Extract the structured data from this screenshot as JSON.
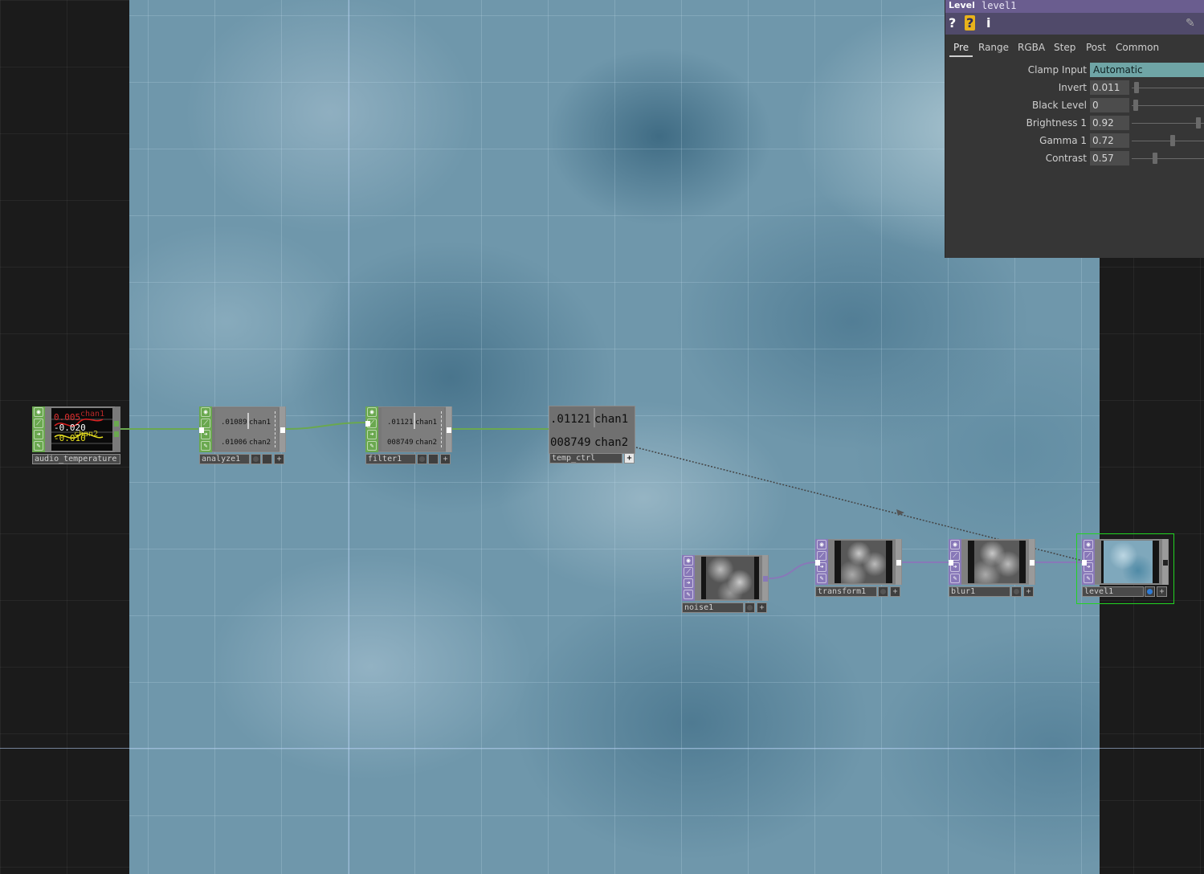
{
  "nodes": {
    "audio_temperature": {
      "label": "audio_temperature",
      "trail_values": [
        "0.005",
        "-0.020",
        "-0.010"
      ],
      "trail_channels": [
        "chan1",
        "chan2"
      ]
    },
    "analyze1": {
      "label": "analyze1",
      "channels": [
        {
          "value": ".01089",
          "name": "chan1"
        },
        {
          "value": ".01006",
          "name": "chan2"
        }
      ]
    },
    "filter1": {
      "label": "filter1",
      "channels": [
        {
          "value": ".01121",
          "name": "chan1"
        },
        {
          "value": "008749",
          "name": "chan2"
        }
      ]
    },
    "temp_ctrl": {
      "label": "temp_ctrl",
      "channels": [
        {
          "value": ".01121",
          "name": "chan1"
        },
        {
          "value": "008749",
          "name": "chan2"
        }
      ]
    },
    "noise1": {
      "label": "noise1"
    },
    "transform1": {
      "label": "transform1"
    },
    "blur1": {
      "label": "blur1"
    },
    "level1": {
      "label": "level1"
    }
  },
  "panel": {
    "op_type": "Level",
    "op_name": "level1",
    "tools": {
      "help": "?",
      "help_python": "?",
      "info": "i"
    },
    "tabs": [
      "Pre",
      "Range",
      "RGBA",
      "Step",
      "Post",
      "Common"
    ],
    "active_tab": "Pre",
    "params": {
      "clamp_input": {
        "label": "Clamp Input",
        "value": "Automatic"
      },
      "invert": {
        "label": "Invert",
        "value": "0.011",
        "slider": 0.011
      },
      "black_level": {
        "label": "Black Level",
        "value": "0",
        "slider": 0.0
      },
      "brightness": {
        "label": "Brightness 1",
        "value": "0.92",
        "slider": 0.92
      },
      "gamma": {
        "label": "Gamma 1",
        "value": "0.72",
        "slider": 0.54
      },
      "contrast": {
        "label": "Contrast",
        "value": "0.57",
        "slider": 0.28
      }
    }
  },
  "colors": {
    "chop": "#6aa84f",
    "top": "#8878b8",
    "selected": "#22d422",
    "panel_title": "#6a5d8f",
    "menu": "#6fa5a6"
  }
}
